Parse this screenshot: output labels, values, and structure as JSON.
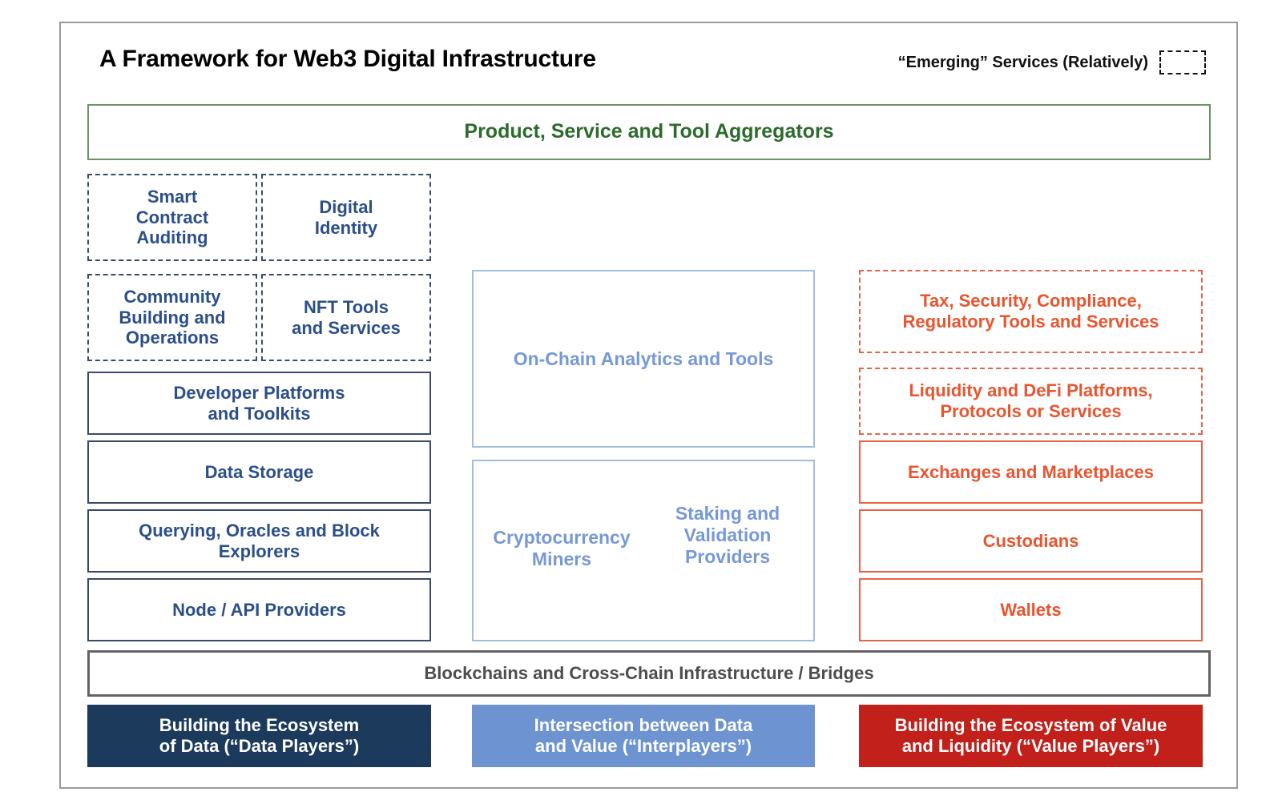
{
  "header": {
    "title": "A Framework for Web3 Digital Infrastructure",
    "legend_label": "“Emerging” Services (Relatively)"
  },
  "aggregators": {
    "label": "Product, Service and Tool Aggregators"
  },
  "data_column": {
    "emerging": [
      {
        "label": "Smart\nContract\nAuditing"
      },
      {
        "label": "Digital\nIdentity"
      },
      {
        "label": "Community\nBuilding and\nOperations"
      },
      {
        "label": "NFT Tools\nand Services"
      }
    ],
    "established": [
      {
        "label": "Developer Platforms\nand Toolkits"
      },
      {
        "label": "Data Storage"
      },
      {
        "label": "Querying, Oracles and Block\nExplorers"
      },
      {
        "label": "Node / API Providers"
      }
    ]
  },
  "interplayer_column": {
    "analytics": "On-Chain Analytics and Tools",
    "miners": "Cryptocurrency\nMiners",
    "staking": "Staking and\nValidation\nProviders"
  },
  "value_column": {
    "emerging": [
      {
        "label": "Tax, Security, Compliance,\nRegulatory Tools and Services"
      },
      {
        "label": "Liquidity and DeFi Platforms,\nProtocols or Services"
      }
    ],
    "established": [
      {
        "label": "Exchanges and Marketplaces"
      },
      {
        "label": "Custodians"
      },
      {
        "label": "Wallets"
      }
    ]
  },
  "foundation": {
    "label": "Blockchains and Cross-Chain Infrastructure / Bridges"
  },
  "footer": {
    "data_players": "Building the Ecosystem\nof Data (“Data Players”)",
    "interplayers": "Intersection between Data\nand Value (“Interplayers”)",
    "value_players": "Building the Ecosystem of Value\nand Liquidity (“Value Players”)"
  },
  "colors": {
    "data_accent": "#2b4f88",
    "interplayer_accent": "#7699d4",
    "value_accent": "#e8552f",
    "aggregator_accent": "#2c6b2c",
    "foundation_accent": "#4d4d4d",
    "data_footer_bg": "#1b3a5c",
    "interplayer_footer_bg": "#6d94d1",
    "value_footer_bg": "#c1201b",
    "frame_border": "#9a9a9a"
  }
}
